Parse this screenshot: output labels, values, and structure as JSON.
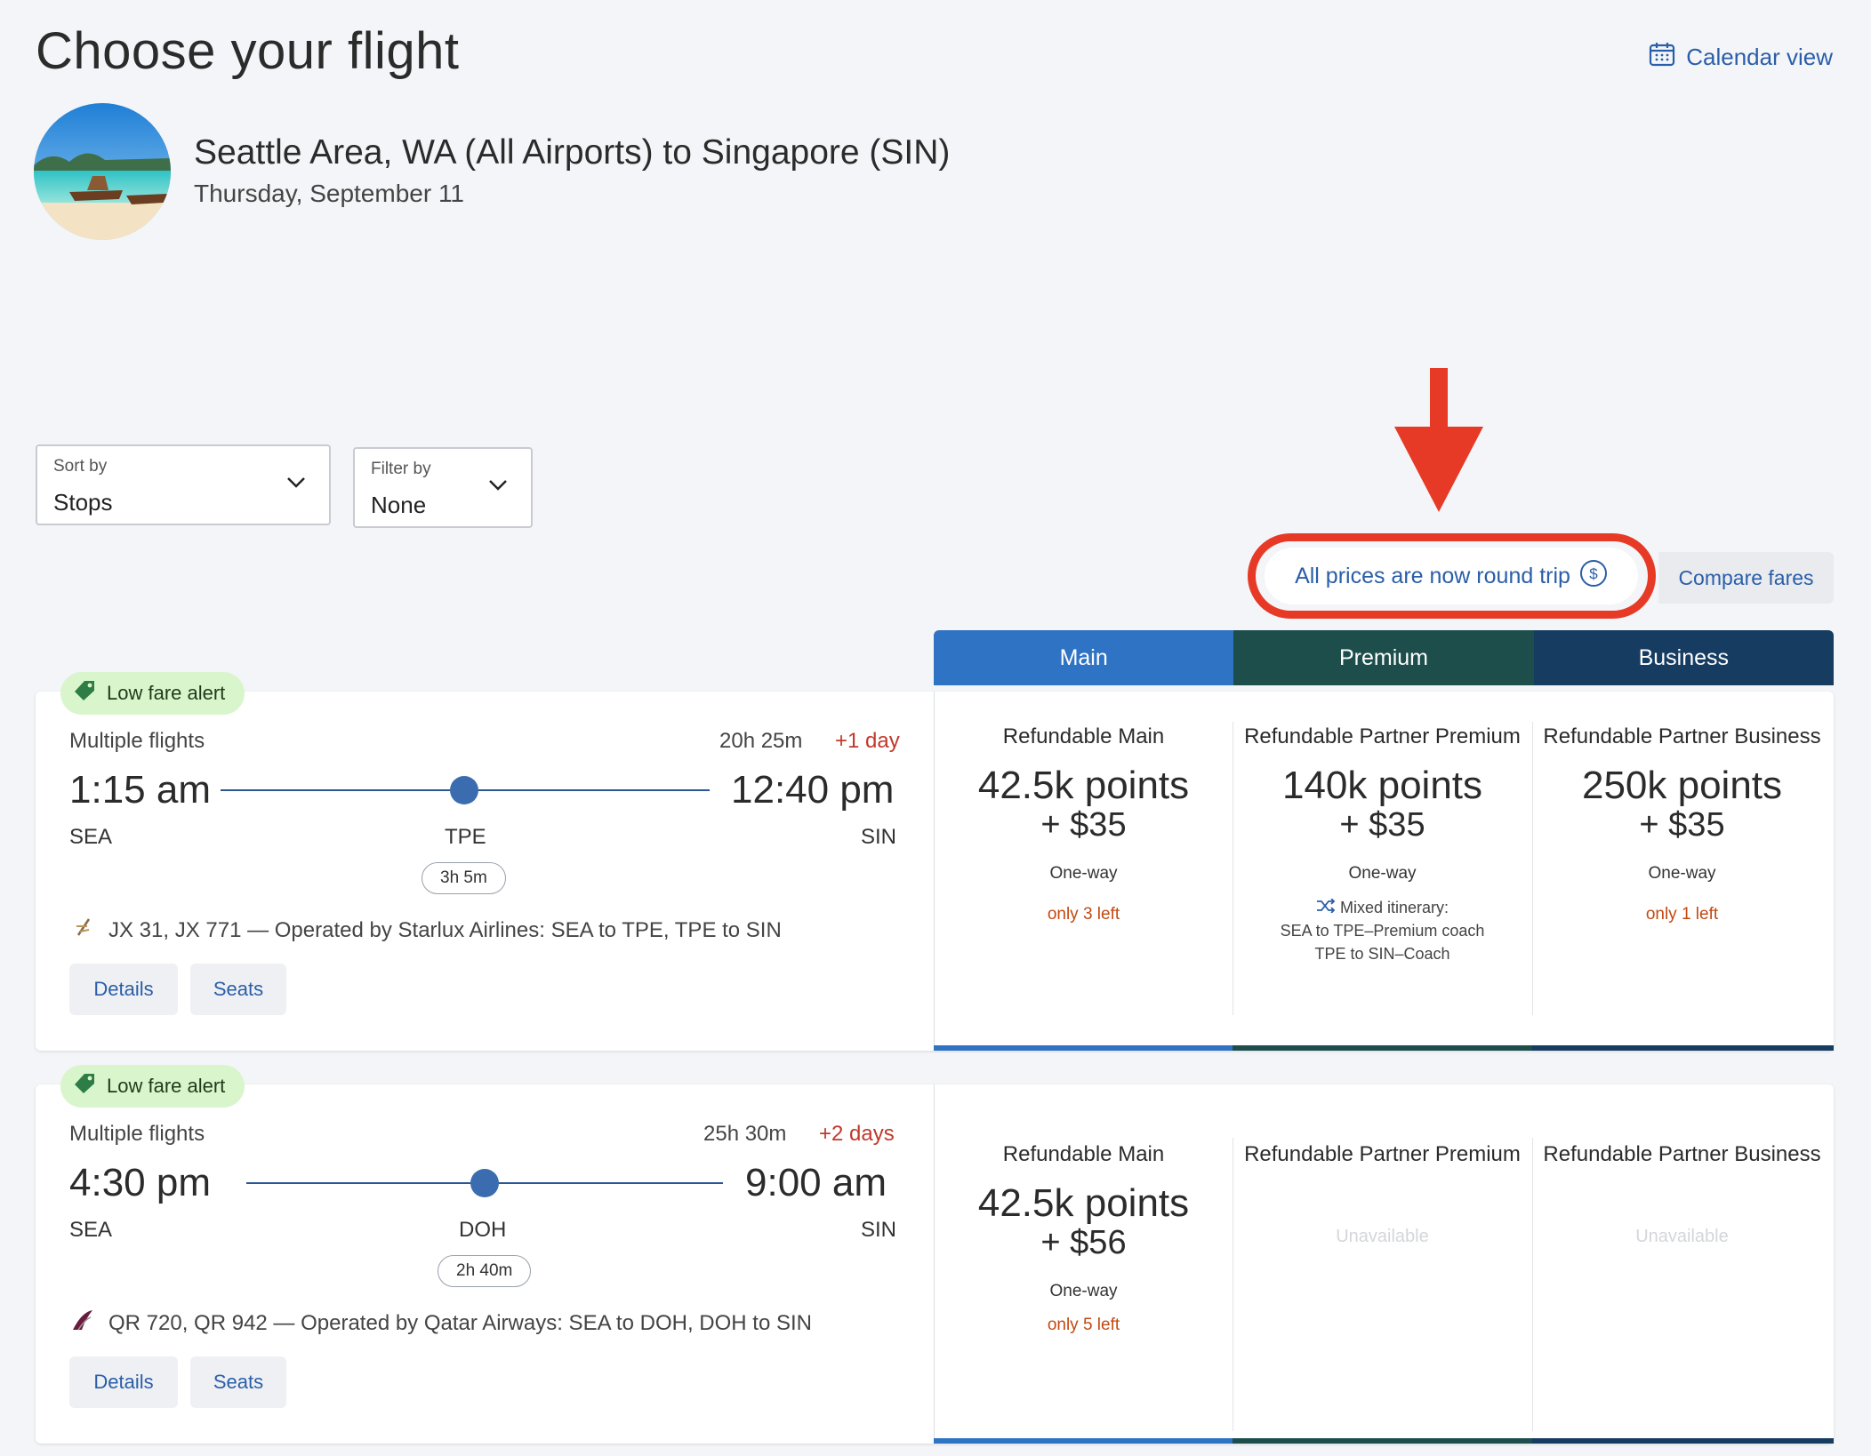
{
  "header": {
    "title": "Choose your flight",
    "calendar_link": "Calendar view",
    "route": "Seattle Area, WA (All Airports) to Singapore (SIN)",
    "date": "Thursday, September 11"
  },
  "controls": {
    "sort_label": "Sort by",
    "sort_value": "Stops",
    "filter_label": "Filter by",
    "filter_value": "None",
    "round_trip_notice": "All prices are now round trip",
    "compare_fares": "Compare fares"
  },
  "cabins": [
    "Main",
    "Premium",
    "Business"
  ],
  "colors": {
    "main": "#2f73c4",
    "premium": "#1d4e4c",
    "business": "#173c62",
    "link": "#2a5ea8",
    "alert_red": "#e63a27"
  },
  "flights": [
    {
      "badge": "Low fare alert",
      "label": "Multiple flights",
      "duration": "20h 25m",
      "day_offset": "+1 day",
      "depart_time": "1:15 am",
      "arrive_time": "12:40 pm",
      "origin": "SEA",
      "stop": "TPE",
      "destination": "SIN",
      "layover": "3h 5m",
      "operated": "JX 31, JX 771 — Operated by Starlux Airlines: SEA to TPE, TPE to SIN",
      "details_btn": "Details",
      "seats_btn": "Seats",
      "fares": [
        {
          "title": "Refundable Main",
          "points": "42.5k points",
          "fee": "+ $35",
          "way": "One-way",
          "left": "only 3 left"
        },
        {
          "title": "Refundable Partner Premium",
          "points": "140k points",
          "fee": "+ $35",
          "way": "One-way",
          "mixed_label": "Mixed itinerary:",
          "mixed_1": "SEA to TPE–Premium coach",
          "mixed_2": "TPE to SIN–Coach"
        },
        {
          "title": "Refundable Partner Business",
          "points": "250k points",
          "fee": "+ $35",
          "way": "One-way",
          "left": "only 1 left"
        }
      ]
    },
    {
      "badge": "Low fare alert",
      "label": "Multiple flights",
      "duration": "25h 30m",
      "day_offset": "+2 days",
      "depart_time": "4:30 pm",
      "arrive_time": "9:00 am",
      "origin": "SEA",
      "stop": "DOH",
      "destination": "SIN",
      "layover": "2h 40m",
      "operated": "QR 720, QR 942 — Operated by Qatar Airways: SEA to DOH, DOH to SIN",
      "details_btn": "Details",
      "seats_btn": "Seats",
      "fares": [
        {
          "title": "Refundable Main",
          "points": "42.5k points",
          "fee": "+ $56",
          "way": "One-way",
          "left": "only 5 left"
        },
        {
          "title": "Refundable Partner Premium",
          "unavailable": "Unavailable"
        },
        {
          "title": "Refundable Partner Business",
          "unavailable": "Unavailable"
        }
      ]
    }
  ]
}
